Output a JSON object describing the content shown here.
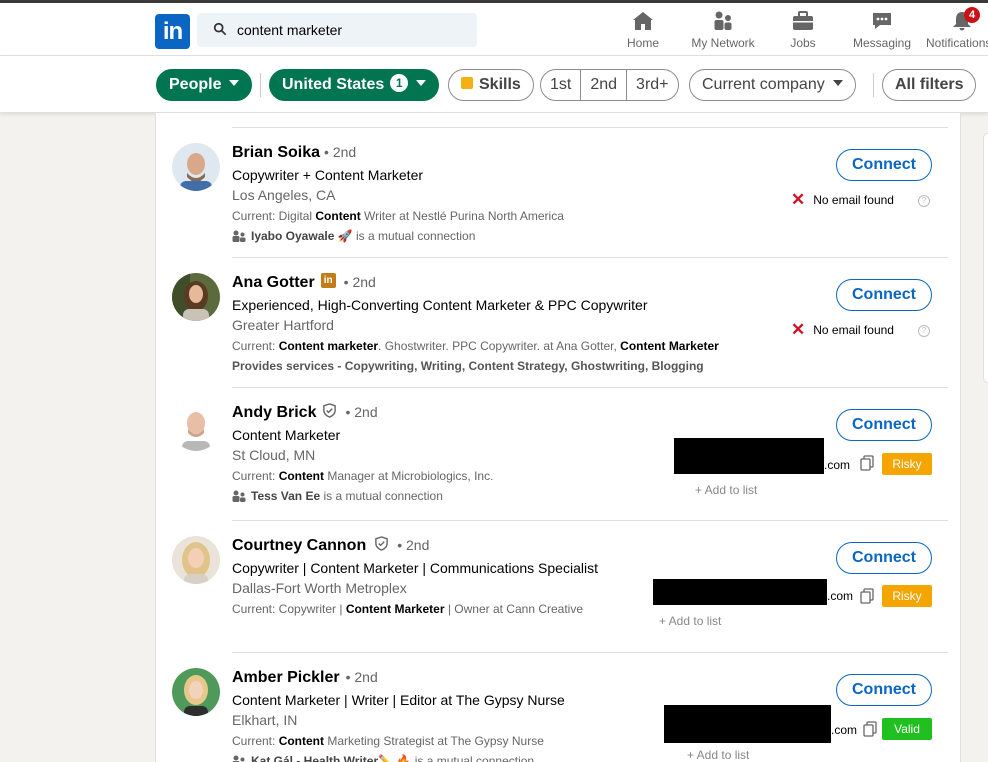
{
  "nav": {
    "search_value": "content marketer",
    "items": [
      {
        "label": "Home",
        "icon": "home-icon"
      },
      {
        "label": "My Network",
        "icon": "network-icon"
      },
      {
        "label": "Jobs",
        "icon": "briefcase-icon"
      },
      {
        "label": "Messaging",
        "icon": "messaging-icon"
      },
      {
        "label": "Notifications",
        "icon": "bell-icon",
        "badge": "4"
      }
    ]
  },
  "filters": {
    "people": "People",
    "location": "United States",
    "location_count": "1",
    "skills": "Skills",
    "degree": [
      "1st",
      "2nd",
      "3rd+"
    ],
    "company": "Current company",
    "all": "All filters"
  },
  "colors": {
    "brand": "#0a66c2",
    "green": "#01754f",
    "risky": "#f5a500",
    "valid": "#1fc01f"
  },
  "results": [
    {
      "name": "Brian Soika",
      "degree": "• 2nd",
      "headline": "Copywriter + Content Marketer",
      "location": "Los Angeles, CA",
      "current_prefix": "Current: Digital ",
      "current_bold": "Content",
      "current_rest": " Writer at Nestlé Purina North America",
      "mutual_name": "Iyabo Oyawale 🚀",
      "mutual_rest": " is a mutual connection",
      "connect": "Connect",
      "email_status": "No email found"
    },
    {
      "name": "Ana Gotter",
      "degree": "• 2nd",
      "headline": "Experienced, High-Converting Content Marketer & PPC Copywriter",
      "location": "Greater Hartford",
      "current_prefix": "Current: ",
      "current_bold": "Content marketer",
      "current_rest": ". Ghostwriter. PPC Copywriter. at Ana Gotter, ",
      "current_bold2": "Content Marketer",
      "services": "Provides services - Copywriting, Writing, Content Strategy, Ghostwriting, Blogging",
      "connect": "Connect",
      "email_status": "No email found"
    },
    {
      "name": "Andy Brick",
      "degree": "• 2nd",
      "headline": "Content Marketer",
      "location": "St Cloud, MN",
      "current_prefix": "Current: ",
      "current_bold": "Content",
      "current_rest": " Manager at Microbiologics, Inc.",
      "mutual_name": "Tess Van Ee",
      "mutual_rest": " is a mutual connection",
      "connect": "Connect",
      "email_domain": ".com",
      "email_status": "Risky",
      "add_to_list": "+ Add to list"
    },
    {
      "name": "Courtney Cannon",
      "degree": "• 2nd",
      "headline": "Copywriter | Content Marketer | Communications Specialist",
      "location": "Dallas-Fort Worth Metroplex",
      "current_prefix": "Current: Copywriter | ",
      "current_bold": "Content Marketer",
      "current_rest": " | Owner at Cann Creative",
      "connect": "Connect",
      "email_domain": ".com",
      "email_status": "Risky",
      "add_to_list": "+ Add to list"
    },
    {
      "name": "Amber Pickler",
      "degree": "• 2nd",
      "headline": "Content Marketer | Writer | Editor at The Gypsy Nurse",
      "location": "Elkhart, IN",
      "current_prefix": "Current: ",
      "current_bold": "Content",
      "current_rest": " Marketing Strategist at The Gypsy Nurse",
      "mutual_name": "Kat Gál - Health Writer✏️ 🔥",
      "mutual_rest": " is a mutual connection",
      "connect": "Connect",
      "email_domain": ".com",
      "email_status": "Valid",
      "add_to_list": "+ Add to list"
    }
  ]
}
